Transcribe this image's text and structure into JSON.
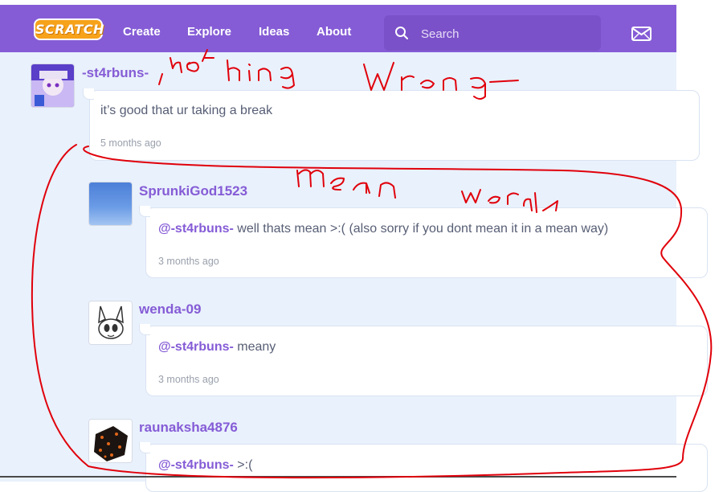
{
  "nav": {
    "logo": "SCRATCH",
    "links": [
      "Create",
      "Explore",
      "Ideas",
      "About"
    ],
    "search_placeholder": "Search"
  },
  "comments": [
    {
      "username": "-st4rbuns-",
      "mention": "",
      "text": "it’s good that ur taking a break",
      "time": "5 months ago"
    },
    {
      "username": "SprunkiGod1523",
      "mention": "@-st4rbuns-",
      "text": " well thats mean >:( (also sorry if you dont mean it in a mean way)",
      "time": "3 months ago"
    },
    {
      "username": "wenda-09",
      "mention": "@-st4rbuns-",
      "text": " meany",
      "time": "3 months ago"
    },
    {
      "username": "raunaksha4876",
      "mention": "@-st4rbuns-",
      "text": " >:(",
      "time": ""
    }
  ],
  "annotations": {
    "note1": "not hing wrong",
    "note2": "mean words"
  },
  "colors": {
    "nav": "#855cd6",
    "accent": "#855cd6",
    "annotation": "#e0000b"
  }
}
